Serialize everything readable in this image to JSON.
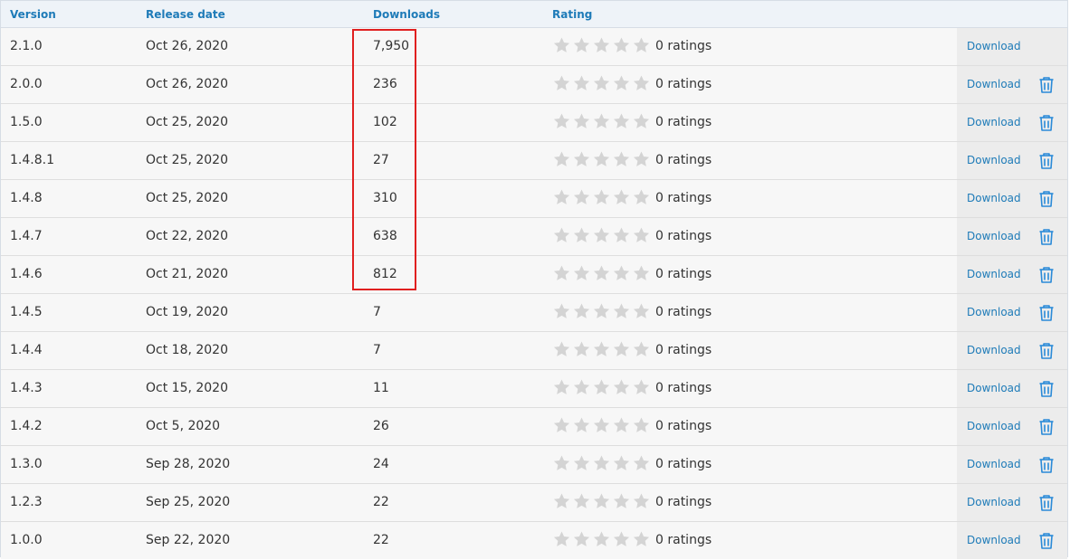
{
  "header": {
    "version": "Version",
    "release_date": "Release date",
    "downloads": "Downloads",
    "rating": "Rating"
  },
  "rows": [
    {
      "version": "2.1.0",
      "date": "Oct 26, 2020",
      "downloads": "7,950",
      "rating": "0 ratings",
      "download": "Download",
      "can_delete": false
    },
    {
      "version": "2.0.0",
      "date": "Oct 26, 2020",
      "downloads": "236",
      "rating": "0 ratings",
      "download": "Download",
      "can_delete": true
    },
    {
      "version": "1.5.0",
      "date": "Oct 25, 2020",
      "downloads": "102",
      "rating": "0 ratings",
      "download": "Download",
      "can_delete": true
    },
    {
      "version": "1.4.8.1",
      "date": "Oct 25, 2020",
      "downloads": "27",
      "rating": "0 ratings",
      "download": "Download",
      "can_delete": true
    },
    {
      "version": "1.4.8",
      "date": "Oct 25, 2020",
      "downloads": "310",
      "rating": "0 ratings",
      "download": "Download",
      "can_delete": true
    },
    {
      "version": "1.4.7",
      "date": "Oct 22, 2020",
      "downloads": "638",
      "rating": "0 ratings",
      "download": "Download",
      "can_delete": true
    },
    {
      "version": "1.4.6",
      "date": "Oct 21, 2020",
      "downloads": "812",
      "rating": "0 ratings",
      "download": "Download",
      "can_delete": true
    },
    {
      "version": "1.4.5",
      "date": "Oct 19, 2020",
      "downloads": "7",
      "rating": "0 ratings",
      "download": "Download",
      "can_delete": true
    },
    {
      "version": "1.4.4",
      "date": "Oct 18, 2020",
      "downloads": "7",
      "rating": "0 ratings",
      "download": "Download",
      "can_delete": true
    },
    {
      "version": "1.4.3",
      "date": "Oct 15, 2020",
      "downloads": "11",
      "rating": "0 ratings",
      "download": "Download",
      "can_delete": true
    },
    {
      "version": "1.4.2",
      "date": "Oct 5, 2020",
      "downloads": "26",
      "rating": "0 ratings",
      "download": "Download",
      "can_delete": true
    },
    {
      "version": "1.3.0",
      "date": "Sep 28, 2020",
      "downloads": "24",
      "rating": "0 ratings",
      "download": "Download",
      "can_delete": true
    },
    {
      "version": "1.2.3",
      "date": "Sep 25, 2020",
      "downloads": "22",
      "rating": "0 ratings",
      "download": "Download",
      "can_delete": true
    },
    {
      "version": "1.0.0",
      "date": "Sep 22, 2020",
      "downloads": "22",
      "rating": "0 ratings",
      "download": "Download",
      "can_delete": true
    }
  ],
  "stars": {
    "count": 5,
    "filled": 0,
    "empty_color": "#d4d4d4"
  },
  "colors": {
    "accent": "#1e7bb8",
    "highlight": "#e02020"
  }
}
